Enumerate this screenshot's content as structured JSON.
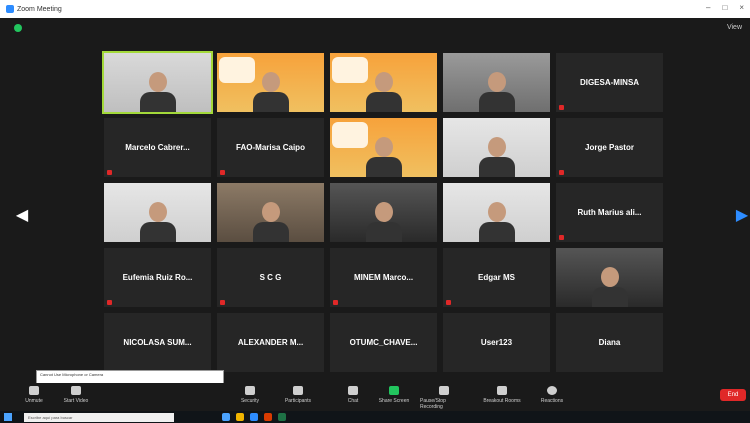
{
  "window": {
    "title": "Zoom Meeting",
    "minimize": "–",
    "maximize": "□",
    "close": "×"
  },
  "topbar": {
    "view_label": "View"
  },
  "participants": [
    {
      "tile": "video",
      "name": "",
      "bg": "office",
      "active": true,
      "muted": false
    },
    {
      "tile": "video",
      "name": "",
      "bg": "orange",
      "active": false,
      "muted": false
    },
    {
      "tile": "video",
      "name": "",
      "bg": "orange",
      "active": false,
      "muted": false
    },
    {
      "tile": "video",
      "name": "",
      "bg": "gray",
      "active": false,
      "muted": false
    },
    {
      "tile": "name",
      "name": "DIGESA-MINSA",
      "muted": true
    },
    {
      "tile": "name",
      "name": "Marcelo Cabrer...",
      "muted": true
    },
    {
      "tile": "name",
      "name": "FAO-Marisa Caipo",
      "muted": true
    },
    {
      "tile": "video",
      "name": "",
      "bg": "orange",
      "active": false,
      "muted": false
    },
    {
      "tile": "video",
      "name": "",
      "bg": "light",
      "active": false,
      "muted": false
    },
    {
      "tile": "name",
      "name": "Jorge Pastor",
      "muted": true
    },
    {
      "tile": "video",
      "name": "",
      "bg": "light",
      "active": false,
      "muted": false
    },
    {
      "tile": "video",
      "name": "",
      "bg": "brown",
      "active": false,
      "muted": false
    },
    {
      "tile": "video",
      "name": "",
      "bg": "dark",
      "active": false,
      "muted": false
    },
    {
      "tile": "video",
      "name": "",
      "bg": "light",
      "active": false,
      "muted": false
    },
    {
      "tile": "name",
      "name": "Ruth Marius ali...",
      "muted": true
    },
    {
      "tile": "name",
      "name": "Eufemia Ruiz Ro...",
      "muted": true
    },
    {
      "tile": "name",
      "name": "S C G",
      "muted": true
    },
    {
      "tile": "name",
      "name": "MINEM Marco...",
      "muted": true
    },
    {
      "tile": "name",
      "name": "Edgar MS",
      "muted": true
    },
    {
      "tile": "video",
      "name": "",
      "bg": "dark",
      "active": false,
      "muted": false
    },
    {
      "tile": "name",
      "name": "NICOLASA SUM...",
      "muted": false
    },
    {
      "tile": "name",
      "name": "ALEXANDER M...",
      "muted": false
    },
    {
      "tile": "name",
      "name": "OTUMC_CHAVE...",
      "muted": false
    },
    {
      "tile": "name",
      "name": "User123",
      "muted": false
    },
    {
      "tile": "name",
      "name": "Diana",
      "muted": false
    }
  ],
  "toolbar": {
    "items": [
      {
        "label": "Unmute",
        "icon": "microphone-icon"
      },
      {
        "label": "Start Video",
        "icon": "video-camera-icon"
      },
      {
        "label": "Security",
        "icon": "shield-icon"
      },
      {
        "label": "Participants",
        "icon": "participants-icon"
      },
      {
        "label": "Chat",
        "icon": "chat-icon"
      },
      {
        "label": "Share Screen",
        "icon": "share-screen-icon"
      },
      {
        "label": "Pause/Stop Recording",
        "icon": "recording-icon"
      },
      {
        "label": "Breakout Rooms",
        "icon": "breakout-rooms-icon"
      },
      {
        "label": "Reactions",
        "icon": "reactions-icon"
      }
    ],
    "end_label": "End"
  },
  "tooltip": {
    "text": "Cannot Use Microphone or Camera"
  },
  "taskbar": {
    "search_placeholder": "Escribe aquí para buscar"
  },
  "colors": {
    "accent": "#2d8cff",
    "active_border": "#a3d93a",
    "mute": "#e02828"
  }
}
